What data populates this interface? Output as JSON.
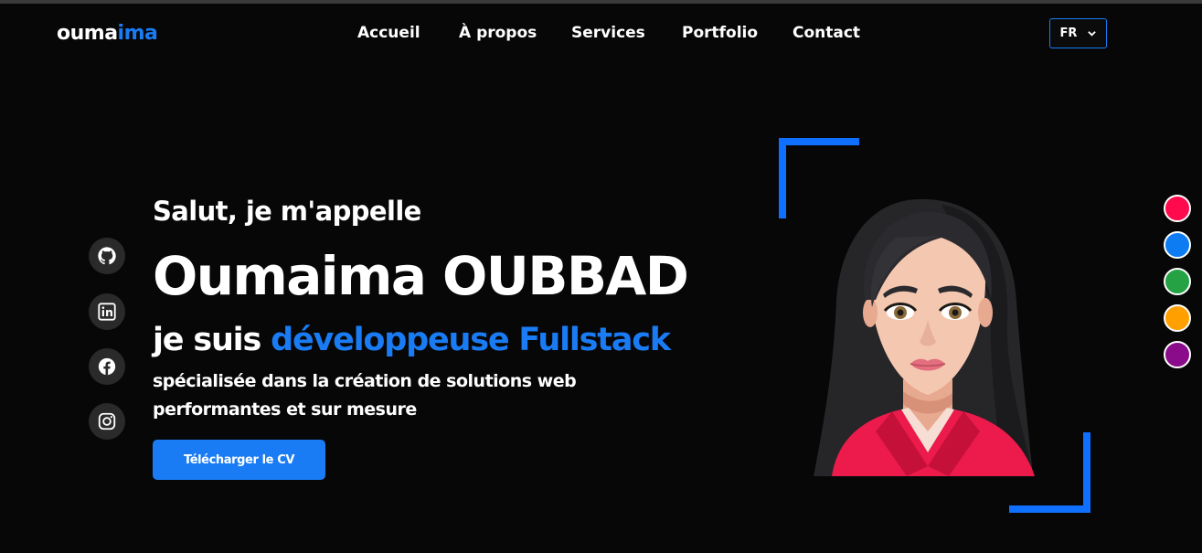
{
  "header": {
    "logo_part1": "ouma",
    "logo_part2": "ima",
    "nav": [
      {
        "label": "Accueil"
      },
      {
        "label": "À propos"
      },
      {
        "label": "Services"
      },
      {
        "label": "Portfolio"
      },
      {
        "label": "Contact"
      }
    ],
    "language": {
      "selected": "FR"
    }
  },
  "social": [
    {
      "icon": "github-icon"
    },
    {
      "icon": "linkedin-icon"
    },
    {
      "icon": "facebook-icon"
    },
    {
      "icon": "instagram-icon"
    }
  ],
  "hero": {
    "greeting": "Salut, je m'appelle",
    "name": "Oumaima OUBBAD",
    "role_prefix": "je suis ",
    "role_highlight": "développeuse Fullstack",
    "description": "spécialisée dans la création de solutions web performantes et sur mesure",
    "cv_button": "Télécharger le CV"
  },
  "theme_colors": [
    "#ff0a4d",
    "#0d7cf2",
    "#25a244",
    "#ff9f00",
    "#8a0c8a"
  ],
  "accent_color": "#1a7cf5"
}
